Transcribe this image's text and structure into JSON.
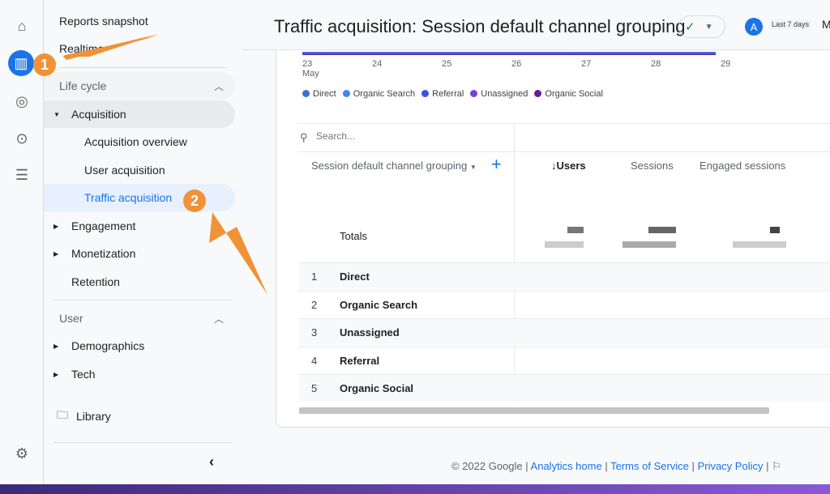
{
  "nav": {
    "reports_snapshot": "Reports snapshot",
    "realtime": "Realtime",
    "lifecycle": "Life cycle",
    "acquisition": "Acquisition",
    "acq_overview": "Acquisition overview",
    "user_acq": "User acquisition",
    "traffic_acq": "Traffic acquisition",
    "engagement": "Engagement",
    "monetization": "Monetization",
    "retention": "Retention",
    "user": "User",
    "demographics": "Demographics",
    "tech": "Tech",
    "library": "Library"
  },
  "header": {
    "title": "Traffic acquisition: Session default channel grouping",
    "avatar": "A",
    "date_range": "Last 7 days",
    "more": "M"
  },
  "chart": {
    "x_ticks": [
      "23",
      "24",
      "25",
      "26",
      "27",
      "28",
      "29"
    ],
    "month": "May",
    "legend": [
      {
        "name": "Direct",
        "color": "#3b6fd6"
      },
      {
        "name": "Organic Search",
        "color": "#4285f4"
      },
      {
        "name": "Referral",
        "color": "#3f4fe0"
      },
      {
        "name": "Unassigned",
        "color": "#7b3fd6"
      },
      {
        "name": "Organic Social",
        "color": "#6a1b9a"
      }
    ]
  },
  "table": {
    "search_placeholder": "Search...",
    "dimension": "Session default channel grouping",
    "columns": [
      "↓Users",
      "Sessions",
      "Engaged sessions"
    ],
    "totals": "Totals",
    "rows": [
      {
        "n": "1",
        "label": "Direct"
      },
      {
        "n": "2",
        "label": "Organic Search"
      },
      {
        "n": "3",
        "label": "Unassigned"
      },
      {
        "n": "4",
        "label": "Referral"
      },
      {
        "n": "5",
        "label": "Organic Social"
      }
    ]
  },
  "annotations": {
    "step1": "1",
    "step2": "2"
  },
  "footer": {
    "copyright": "© 2022 Google |",
    "analytics_home": "Analytics home",
    "tos": "Terms of Service",
    "privacy": "Privacy Policy",
    "sep": "|"
  }
}
